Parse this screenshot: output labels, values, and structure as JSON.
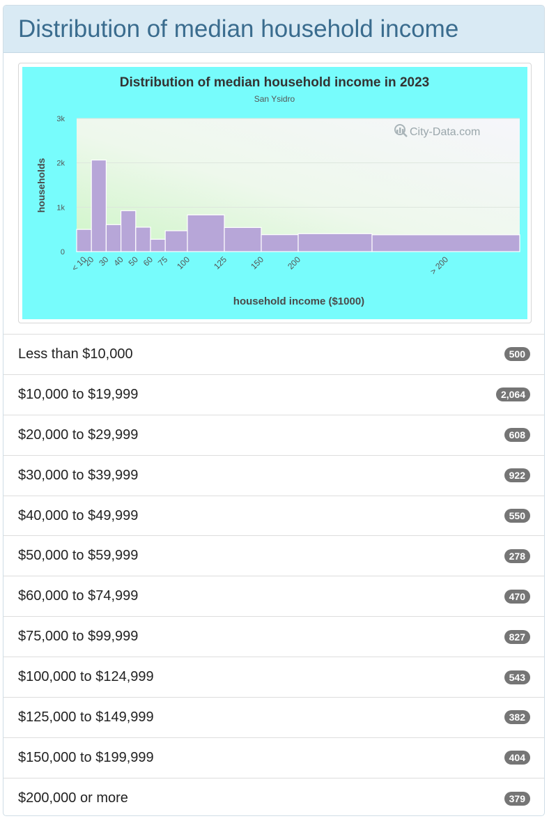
{
  "panel": {
    "title": "Distribution of median household income"
  },
  "chart_data": {
    "type": "bar",
    "title": "Distribution of median household income in 2023",
    "subtitle": "San Ysidro",
    "xlabel": "household income ($1000)",
    "ylabel": "households",
    "watermark": "City-Data.com",
    "ylim": [
      0,
      3000
    ],
    "yticks": [
      {
        "value": 0,
        "label": "0"
      },
      {
        "value": 1000,
        "label": "1k"
      },
      {
        "value": 2000,
        "label": "2k"
      },
      {
        "value": 3000,
        "label": "3k"
      }
    ],
    "xticks": [
      "< 10",
      "20",
      "30",
      "40",
      "50",
      "60",
      "75",
      "100",
      "125",
      "150",
      "200",
      "> 200"
    ],
    "bins": [
      {
        "from": 0,
        "to": 10,
        "value": 500
      },
      {
        "from": 10,
        "to": 20,
        "value": 2064
      },
      {
        "from": 20,
        "to": 30,
        "value": 608
      },
      {
        "from": 30,
        "to": 40,
        "value": 922
      },
      {
        "from": 40,
        "to": 50,
        "value": 550
      },
      {
        "from": 50,
        "to": 60,
        "value": 278
      },
      {
        "from": 60,
        "to": 75,
        "value": 470
      },
      {
        "from": 75,
        "to": 100,
        "value": 827
      },
      {
        "from": 100,
        "to": 125,
        "value": 543
      },
      {
        "from": 125,
        "to": 150,
        "value": 382
      },
      {
        "from": 150,
        "to": 200,
        "value": 404
      },
      {
        "from": 200,
        "to": 300,
        "value": 379
      }
    ],
    "bar_color": "#b7a6d8",
    "background_color": "#77fcfc",
    "grid": true
  },
  "rows": [
    {
      "label": "Less than $10,000",
      "count": "500"
    },
    {
      "label": "$10,000 to $19,999",
      "count": "2,064"
    },
    {
      "label": "$20,000 to $29,999",
      "count": "608"
    },
    {
      "label": "$30,000 to $39,999",
      "count": "922"
    },
    {
      "label": "$40,000 to $49,999",
      "count": "550"
    },
    {
      "label": "$50,000 to $59,999",
      "count": "278"
    },
    {
      "label": "$60,000 to $74,999",
      "count": "470"
    },
    {
      "label": "$75,000 to $99,999",
      "count": "827"
    },
    {
      "label": "$100,000 to $124,999",
      "count": "543"
    },
    {
      "label": "$125,000 to $149,999",
      "count": "382"
    },
    {
      "label": "$150,000 to $199,999",
      "count": "404"
    },
    {
      "label": "$200,000 or more",
      "count": "379"
    }
  ]
}
